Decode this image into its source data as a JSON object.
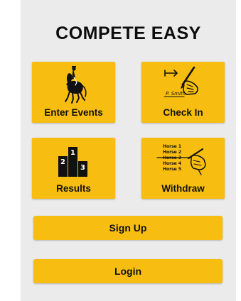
{
  "app": {
    "title": "COMPETE EASY"
  },
  "tiles": {
    "enter_events": {
      "label": "Enter Events",
      "icon": "dressage-rider-icon"
    },
    "check_in": {
      "label": "Check In",
      "icon": "signing-hand-icon",
      "signature": "P. Smith"
    },
    "results": {
      "label": "Results",
      "icon": "podium-icon",
      "podium": [
        "2",
        "1",
        "3"
      ]
    },
    "withdraw": {
      "label": "Withdraw",
      "icon": "strike-list-icon",
      "list": [
        "Horse 1",
        "Horse 2",
        "Horse 3",
        "Horse 4",
        "Horse 5"
      ]
    }
  },
  "buttons": {
    "signup": "Sign Up",
    "login": "Login"
  },
  "colors": {
    "accent": "#f7bd10",
    "panel": "#ebebeb",
    "text": "#111111"
  }
}
